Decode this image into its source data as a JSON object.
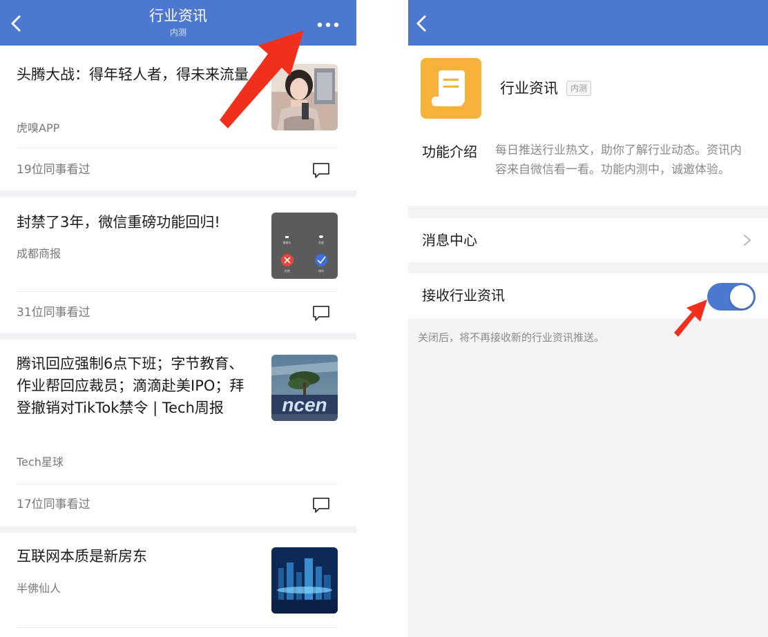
{
  "left": {
    "header": {
      "title": "行业资讯",
      "subtitle": "内测",
      "back_icon": "chevron-left-icon",
      "more_icon": "more-dots-icon"
    },
    "articles": [
      {
        "title": "头腾大战：得年轻人者，得未来流量",
        "source": "虎嗅APP",
        "views": "19位同事看过"
      },
      {
        "title": "封禁了3年，微信重磅功能回归!",
        "source": "成都商报",
        "views": "31位同事看过"
      },
      {
        "title": "腾讯回应强制6点下班；字节教育、作业帮回应裁员；滴滴赴美IPO；拜登撤销对TikTok禁令 | Tech周报",
        "source": "Tech星球",
        "views": "17位同事看过"
      },
      {
        "title": "互联网本质是新房东",
        "source": "半佛仙人"
      }
    ],
    "thumb2": {
      "label_a": "摄像头",
      "label_b": "音量",
      "reject": "拒绝",
      "accept": "接听"
    },
    "thumb3": {
      "text": "ncen"
    }
  },
  "right": {
    "header": {
      "back_icon": "chevron-left-icon"
    },
    "app": {
      "name": "行业资讯",
      "badge": "内测",
      "icon": "scroll-document-icon"
    },
    "intro": {
      "label": "功能介绍",
      "text": "每日推送行业热文，助你了解行业动态。资讯内容来自微信看一看。功能内测中，诚邀体验。"
    },
    "message_center": {
      "label": "消息中心",
      "icon": "chevron-right-icon"
    },
    "receive": {
      "label": "接收行业资讯",
      "enabled": true
    },
    "note": "关闭后，将不再接收新的行业资讯推送。"
  },
  "colors": {
    "header_blue": "#4c78cf",
    "app_icon_orange": "#f6b23b",
    "annotation_red": "#f0301c"
  }
}
